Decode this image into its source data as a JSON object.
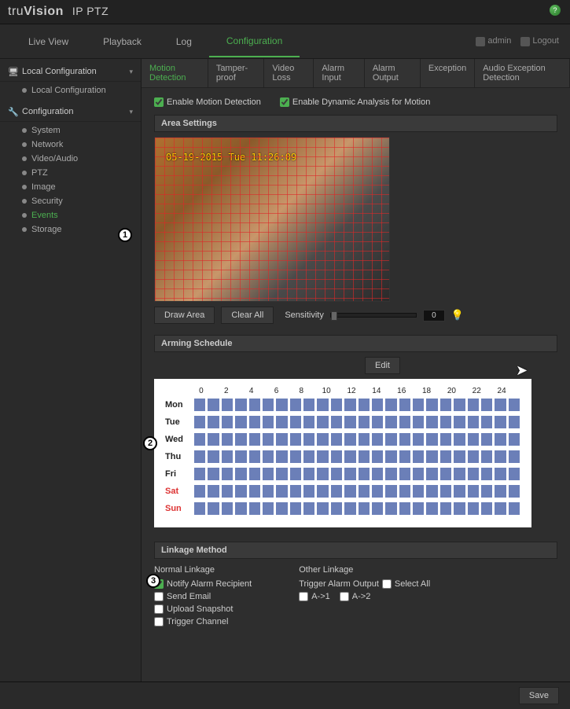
{
  "brand": {
    "logo_prefix": "tru",
    "logo_bold": "Vision",
    "logo_suffix": "IP PTZ"
  },
  "help_icon": "?",
  "mainnav": {
    "items": [
      {
        "label": "Live View",
        "active": false
      },
      {
        "label": "Playback",
        "active": false
      },
      {
        "label": "Log",
        "active": false
      },
      {
        "label": "Configuration",
        "active": true
      }
    ],
    "user": "admin",
    "logout": "Logout"
  },
  "sidebar": {
    "groups": [
      {
        "label": "Local Configuration",
        "icon": "monitor-icon",
        "items": [
          {
            "label": "Local Configuration",
            "active": false
          }
        ]
      },
      {
        "label": "Configuration",
        "icon": "wrench-icon",
        "items": [
          {
            "label": "System",
            "active": false
          },
          {
            "label": "Network",
            "active": false
          },
          {
            "label": "Video/Audio",
            "active": false
          },
          {
            "label": "PTZ",
            "active": false
          },
          {
            "label": "Image",
            "active": false
          },
          {
            "label": "Security",
            "active": false
          },
          {
            "label": "Events",
            "active": true
          },
          {
            "label": "Storage",
            "active": false
          }
        ]
      }
    ]
  },
  "content_tabs": [
    {
      "label": "Motion Detection",
      "active": true
    },
    {
      "label": "Tamper-proof",
      "active": false
    },
    {
      "label": "Video Loss",
      "active": false
    },
    {
      "label": "Alarm Input",
      "active": false
    },
    {
      "label": "Alarm Output",
      "active": false
    },
    {
      "label": "Exception",
      "active": false
    },
    {
      "label": "Audio Exception Detection",
      "active": false
    }
  ],
  "motion": {
    "enable_motion_label": "Enable Motion Detection",
    "enable_motion_checked": true,
    "enable_dynamic_label": "Enable Dynamic Analysis for Motion",
    "enable_dynamic_checked": true,
    "area_section_title": "Area Settings",
    "preview_timestamp": "05-19-2015 Tue 11:26:09",
    "draw_area_btn": "Draw Area",
    "clear_all_btn": "Clear All",
    "sensitivity_label": "Sensitivity",
    "sensitivity_value": "0"
  },
  "schedule": {
    "section_title": "Arming Schedule",
    "edit_btn": "Edit",
    "hours": [
      "0",
      "2",
      "4",
      "6",
      "8",
      "10",
      "12",
      "14",
      "16",
      "18",
      "20",
      "22",
      "24"
    ],
    "days": [
      {
        "label": "Mon",
        "weekend": false
      },
      {
        "label": "Tue",
        "weekend": false
      },
      {
        "label": "Wed",
        "weekend": false
      },
      {
        "label": "Thu",
        "weekend": false
      },
      {
        "label": "Fri",
        "weekend": false
      },
      {
        "label": "Sat",
        "weekend": true
      },
      {
        "label": "Sun",
        "weekend": true
      }
    ]
  },
  "linkage": {
    "section_title": "Linkage Method",
    "normal_heading": "Normal Linkage",
    "other_heading": "Other Linkage",
    "normal": [
      {
        "label": "Notify Alarm Recipient",
        "checked": true
      },
      {
        "label": "Send Email",
        "checked": false
      },
      {
        "label": "Upload Snapshot",
        "checked": false
      },
      {
        "label": "Trigger Channel",
        "checked": false
      }
    ],
    "trigger_output_label": "Trigger Alarm Output",
    "select_all_label": "Select All",
    "select_all_checked": false,
    "outputs": [
      {
        "label": "A->1",
        "checked": false
      },
      {
        "label": "A->2",
        "checked": false
      }
    ]
  },
  "footer": {
    "save_btn": "Save"
  },
  "annotations": {
    "a1": "1",
    "a2": "2",
    "a3": "3"
  }
}
